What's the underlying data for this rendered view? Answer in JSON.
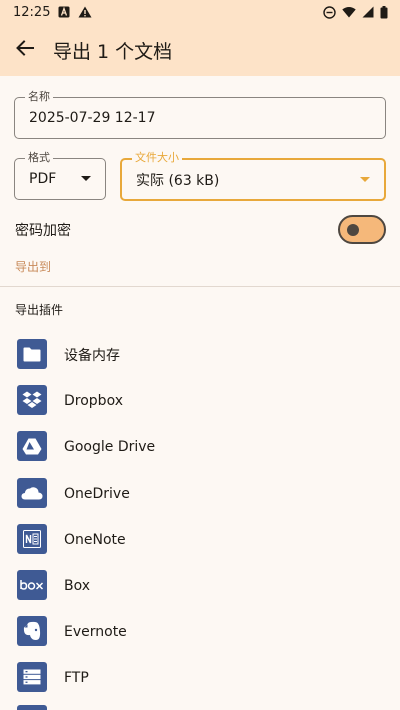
{
  "status_bar": {
    "time": "12:25",
    "left_icons": [
      "notification-a-icon",
      "warning-icon"
    ],
    "right_icons": [
      "do-not-disturb-icon",
      "wifi-icon",
      "signal-icon",
      "battery-icon"
    ]
  },
  "app_bar": {
    "back_icon": "arrow-back-icon",
    "title": "导出 1 个文档"
  },
  "name_field": {
    "label": "名称",
    "value": "2025-07-29 12-17"
  },
  "format_field": {
    "label": "格式",
    "value": "PDF"
  },
  "size_field": {
    "label": "文件大小",
    "value": "实际 (63 kB)"
  },
  "password": {
    "label": "密码加密",
    "enabled": false
  },
  "export_to": {
    "label": "导出到"
  },
  "plugins": {
    "title": "导出插件",
    "items": [
      {
        "label": "设备内存",
        "icon": "folder-icon"
      },
      {
        "label": "Dropbox",
        "icon": "dropbox-icon"
      },
      {
        "label": "Google Drive",
        "icon": "google-drive-icon"
      },
      {
        "label": "OneDrive",
        "icon": "onedrive-icon"
      },
      {
        "label": "OneNote",
        "icon": "onenote-icon"
      },
      {
        "label": "Box",
        "icon": "box-icon"
      },
      {
        "label": "Evernote",
        "icon": "evernote-icon"
      },
      {
        "label": "FTP",
        "icon": "ftp-icon"
      }
    ]
  },
  "colors": {
    "header_bg": "#fde3c8",
    "page_bg": "#fdf8f3",
    "accent": "#e8a83a",
    "plugin_icon_bg": "#3f5a94",
    "toggle_track": "#f5b87a",
    "link_text": "#c88a5a"
  }
}
